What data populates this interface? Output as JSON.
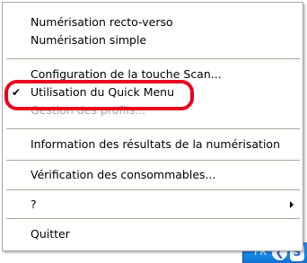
{
  "menu": {
    "items": [
      {
        "label": "Numérisation recto-verso"
      },
      {
        "label": "Numérisation simple"
      },
      {
        "label": "Configuration de la touche Scan..."
      },
      {
        "label": "Utilisation du Quick Menu",
        "check": "✔"
      },
      {
        "label": "Gestion des profils..."
      },
      {
        "label": "Information des résultats de la numérisation"
      },
      {
        "label": "Vérification des consommables..."
      },
      {
        "label": "?"
      },
      {
        "label": "Quitter"
      }
    ]
  },
  "taskbar": {
    "language": "FR",
    "tray_button_glyph": "❮",
    "tray_icon_letter": "S"
  },
  "colors": {
    "highlight_ring": "#e8001c",
    "disabled_text": "#aca899",
    "taskbar_blue": "#0e55cf"
  },
  "icons": {
    "check": "checkmark-icon",
    "submenu": "submenu-arrow-icon"
  }
}
